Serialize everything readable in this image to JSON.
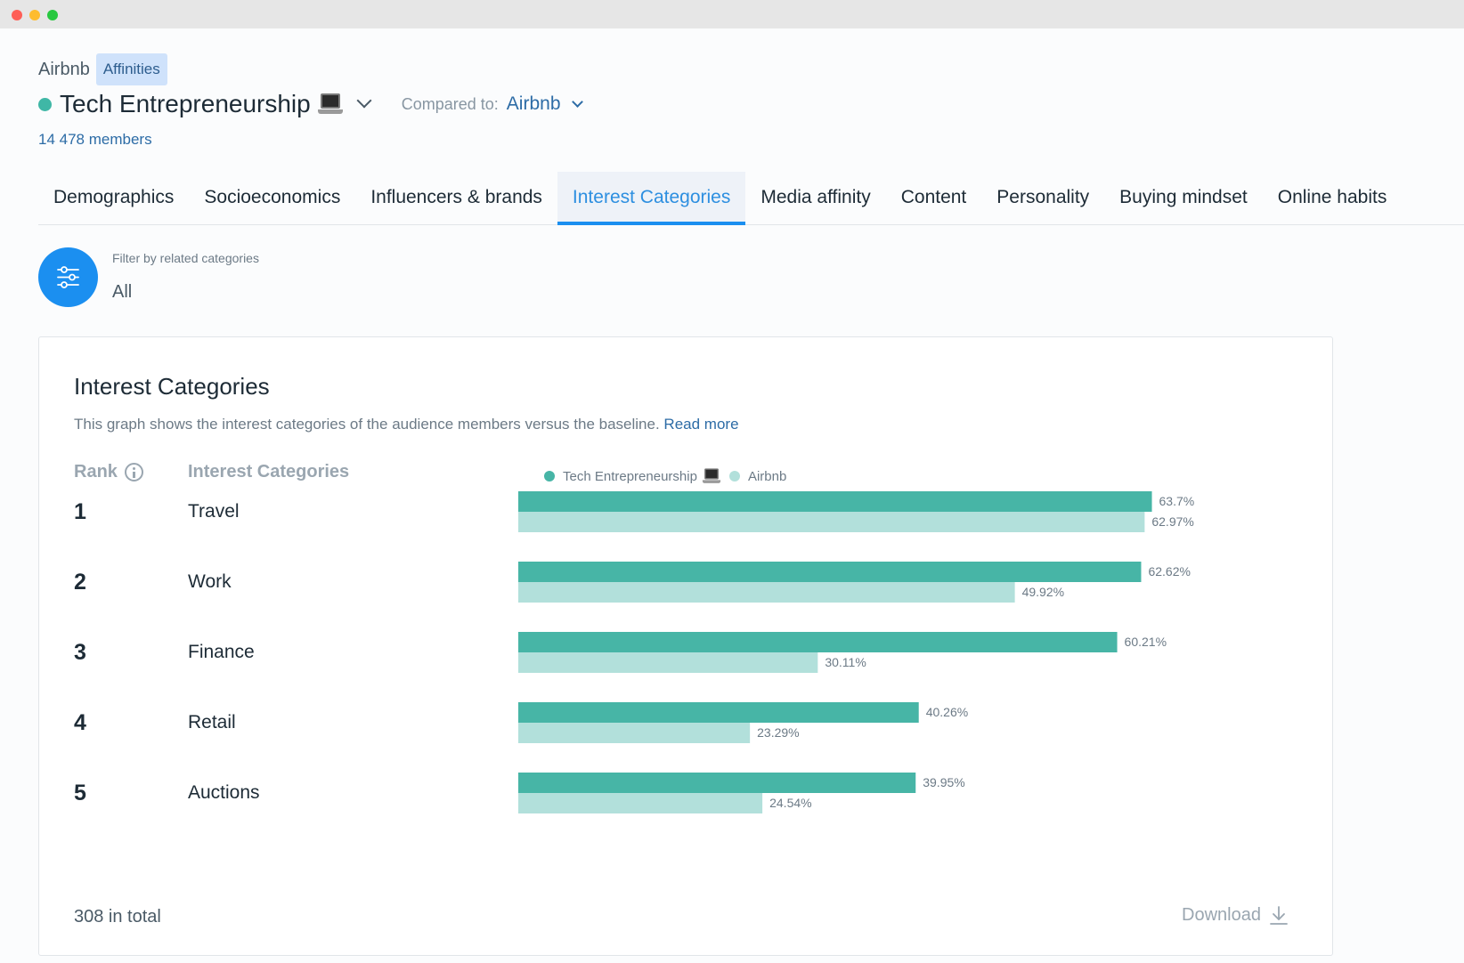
{
  "window": {
    "controls": [
      "close",
      "minimize",
      "maximize"
    ]
  },
  "header": {
    "app": "Airbnb",
    "badge": "Affinities",
    "audience": "Tech Entrepreneurship",
    "audience_icon": "laptop-icon",
    "compared_label": "Compared to:",
    "compared_value": "Airbnb",
    "members": "14 478 members"
  },
  "tabs": [
    {
      "label": "Demographics",
      "active": false
    },
    {
      "label": "Socioeconomics",
      "active": false
    },
    {
      "label": "Influencers & brands",
      "active": false
    },
    {
      "label": "Interest Categories",
      "active": true
    },
    {
      "label": "Media affinity",
      "active": false
    },
    {
      "label": "Content",
      "active": false
    },
    {
      "label": "Personality",
      "active": false
    },
    {
      "label": "Buying mindset",
      "active": false
    },
    {
      "label": "Online habits",
      "active": false
    }
  ],
  "filter": {
    "label": "Filter by related categories",
    "value": "All",
    "icon": "sliders-icon"
  },
  "card": {
    "title": "Interest Categories",
    "description": "This graph shows the interest categories of the audience members versus the baseline.",
    "read_more": "Read more",
    "col_rank": "Rank",
    "col_category": "Interest Categories",
    "total": "308 in total",
    "download": "Download"
  },
  "colors": {
    "primary": "#47b5a6",
    "baseline": "#b2e0db",
    "accent": "#1b8ff0",
    "link": "#2d6ca6"
  },
  "chart_data": {
    "type": "bar",
    "orientation": "horizontal",
    "categories": [
      "Travel",
      "Work",
      "Finance",
      "Retail",
      "Auctions"
    ],
    "ranks": [
      "1",
      "2",
      "3",
      "4",
      "5"
    ],
    "series": [
      {
        "name": "Tech Entrepreneurship",
        "values": [
          63.7,
          62.62,
          60.21,
          40.26,
          39.95
        ],
        "labels": [
          "63.7%",
          "62.62%",
          "60.21%",
          "40.26%",
          "39.95%"
        ],
        "color": "#47b5a6"
      },
      {
        "name": "Airbnb",
        "values": [
          62.97,
          49.92,
          30.11,
          23.29,
          24.54
        ],
        "labels": [
          "62.97%",
          "49.92%",
          "30.11%",
          "23.29%",
          "24.54%"
        ],
        "color": "#b2e0db"
      }
    ],
    "xlim": [
      0,
      100
    ],
    "legend": "top",
    "grid": false
  }
}
